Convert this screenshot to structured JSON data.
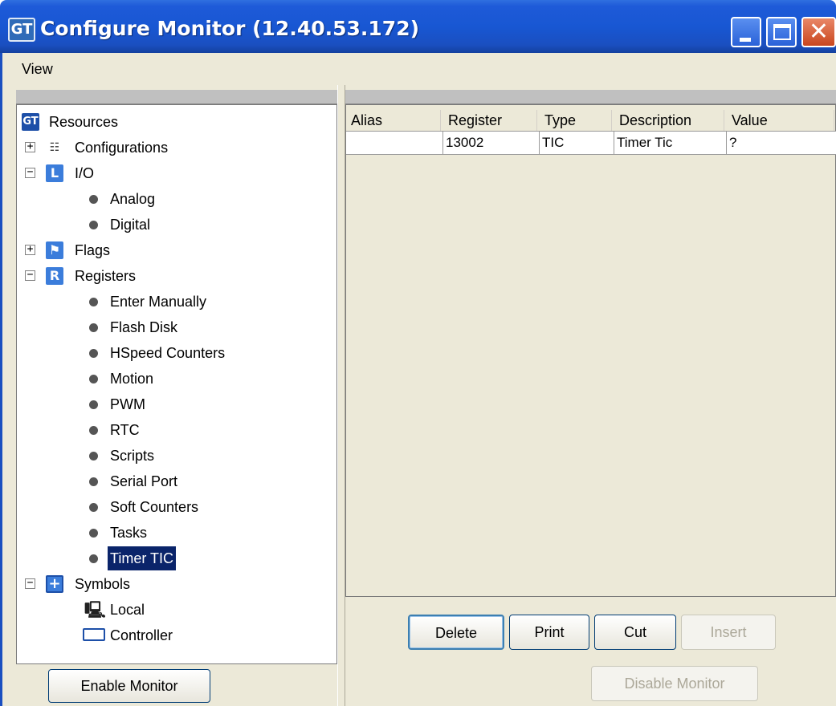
{
  "window": {
    "title": "Configure Monitor (12.40.53.172)",
    "icon_text": "GT"
  },
  "menu": {
    "view": "View"
  },
  "tree": {
    "root": "Resources",
    "configurations": "Configurations",
    "io": "I/O",
    "io_children": [
      "Analog",
      "Digital"
    ],
    "flags": "Flags",
    "registers": "Registers",
    "register_children": [
      "Enter Manually",
      "Flash Disk",
      "HSpeed Counters",
      "Motion",
      "PWM",
      "RTC",
      "Scripts",
      "Serial Port",
      "Soft Counters",
      "Tasks",
      "Timer TIC"
    ],
    "symbols": "Symbols",
    "symbol_children": [
      "Local",
      "Controller"
    ],
    "selected": "Timer TIC",
    "icons": {
      "registers": "R",
      "symbols": "+"
    }
  },
  "table": {
    "columns": [
      "Alias",
      "Register",
      "Type",
      "Description",
      "Value"
    ],
    "rows": [
      {
        "alias": "",
        "register": "13002",
        "type": "TIC",
        "description": "Timer Tic",
        "value": "?"
      }
    ]
  },
  "buttons": {
    "enable_monitor": "Enable Monitor",
    "delete": "Delete",
    "print": "Print",
    "cut": "Cut",
    "insert": "Insert",
    "disable_monitor": "Disable Monitor"
  },
  "colors": {
    "titlebar": "#1857d3",
    "selection": "#0a246a",
    "panel_bg": "#ece9d8"
  }
}
